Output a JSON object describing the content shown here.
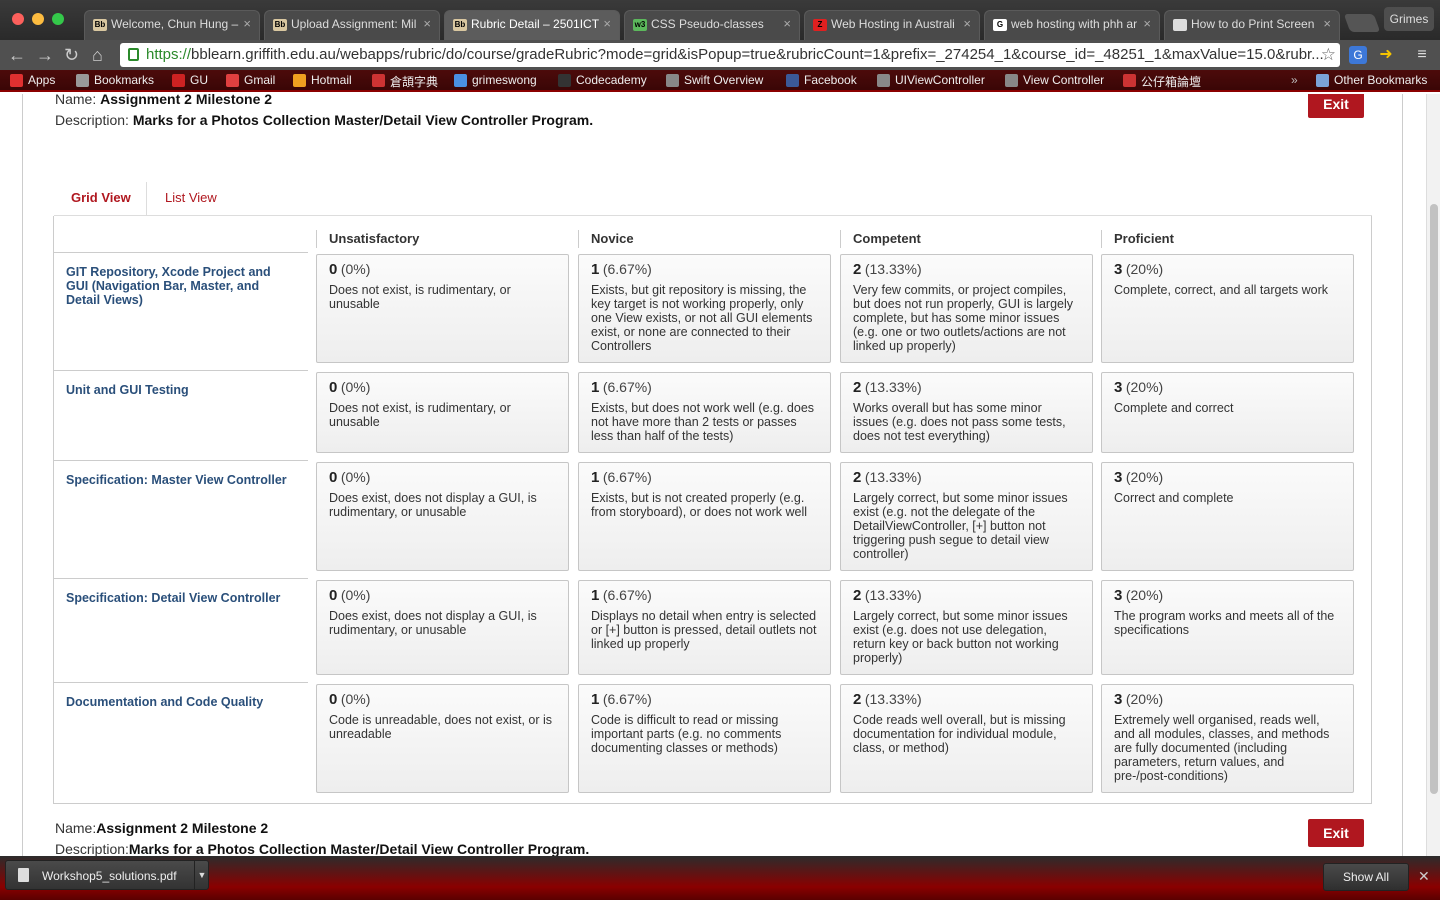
{
  "browser": {
    "tabs": [
      {
        "title": "Welcome, Chun Hung –",
        "favicon": "Bb"
      },
      {
        "title": "Upload Assignment: Mil",
        "favicon": "Bb"
      },
      {
        "title": "Rubric Detail – 2501ICT",
        "favicon": "Bb",
        "active": true
      },
      {
        "title": "CSS Pseudo-classes",
        "favicon": "w3"
      },
      {
        "title": "Web Hosting in Australi",
        "favicon": "Z"
      },
      {
        "title": "web hosting with phh ar",
        "favicon": "G"
      },
      {
        "title": "How to do Print Screen",
        "favicon": "doc"
      }
    ],
    "profile": "Grimes",
    "url_scheme": "https://",
    "url_rest": "bblearn.griffith.edu.au/webapps/rubric/do/course/gradeRubric?mode=grid&isPopup=true&rubricCount=1&prefix=_274254_1&course_id=_48251_1&maxValue=15.0&rubr..."
  },
  "bookmarks": [
    "Apps",
    "Bookmarks",
    "GU",
    "Gmail",
    "Hotmail",
    "倉頡字典",
    "grimeswong",
    "Codecademy",
    "Swift Overview",
    "Facebook",
    "UIViewController",
    "View Controller",
    "公仔箱論壇"
  ],
  "bookmarks_more": "»",
  "bookmarks_other": "Other Bookmarks",
  "rubric": {
    "name_label": "Name:",
    "name": "Assignment 2 Milestone 2",
    "description_label": "Description:",
    "description": "Marks for a Photos Collection Master/Detail View Controller Program.",
    "exit_label": "Exit",
    "tabs": {
      "grid": "Grid View",
      "list": "List View"
    },
    "levels": [
      "Unsatisfactory",
      "Novice",
      "Competent",
      "Proficient"
    ],
    "criteria": [
      {
        "name": "GIT Repository, Xcode Project and GUI (Navigation Bar, Master, and Detail Views)",
        "cells": [
          {
            "points": "0",
            "percent": "(0%)",
            "desc": "Does not exist, is rudimentary, or unusable"
          },
          {
            "points": "1",
            "percent": "(6.67%)",
            "desc": "Exists, but git repository is missing, the key target is not working properly, only one View exists, or not all GUI elements exist, or none are connected to their Controllers"
          },
          {
            "points": "2",
            "percent": "(13.33%)",
            "desc": "Very few commits, or project compiles, but does not run properly, GUI is largely complete, but has some minor issues (e.g. one or two outlets/actions are not linked up properly)"
          },
          {
            "points": "3",
            "percent": "(20%)",
            "desc": "Complete, correct, and all targets work"
          }
        ]
      },
      {
        "name": "Unit and GUI Testing",
        "cells": [
          {
            "points": "0",
            "percent": "(0%)",
            "desc": "Does not exist, is rudimentary, or unusable"
          },
          {
            "points": "1",
            "percent": "(6.67%)",
            "desc": "Exists, but does not work well (e.g. does not have more than 2 tests or passes less than half of the tests)"
          },
          {
            "points": "2",
            "percent": "(13.33%)",
            "desc": "Works overall but has some minor issues (e.g. does not pass some tests, does not test everything)"
          },
          {
            "points": "3",
            "percent": "(20%)",
            "desc": "Complete and correct"
          }
        ]
      },
      {
        "name": "Specification: Master View Controller",
        "cells": [
          {
            "points": "0",
            "percent": "(0%)",
            "desc": "Does exist, does not display a GUI, is rudimentary, or unusable"
          },
          {
            "points": "1",
            "percent": "(6.67%)",
            "desc": "Exists, but is not created properly (e.g. from storyboard), or does not work well"
          },
          {
            "points": "2",
            "percent": "(13.33%)",
            "desc": "Largely correct, but some minor issues exist (e.g. not the delegate of the DetailViewController, [+] button not triggering push segue to detail view controller)"
          },
          {
            "points": "3",
            "percent": "(20%)",
            "desc": "Correct and complete"
          }
        ]
      },
      {
        "name": "Specification: Detail View Controller",
        "cells": [
          {
            "points": "0",
            "percent": "(0%)",
            "desc": "Does exist, does not display a GUI, is rudimentary, or unusable"
          },
          {
            "points": "1",
            "percent": "(6.67%)",
            "desc": "Displays no detail when entry is selected or [+] button is pressed, detail outlets not linked up properly"
          },
          {
            "points": "2",
            "percent": "(13.33%)",
            "desc": "Largely correct, but some minor issues exist (e.g. does not use delegation, return key or back button not working properly)"
          },
          {
            "points": "3",
            "percent": "(20%)",
            "desc": "The program works and meets all of the specifications"
          }
        ]
      },
      {
        "name": "Documentation and Code Quality",
        "cells": [
          {
            "points": "0",
            "percent": "(0%)",
            "desc": "Code is unreadable, does not exist, or is unreadable"
          },
          {
            "points": "1",
            "percent": "(6.67%)",
            "desc": "Code is difficult to read or missing important parts (e.g. no comments documenting classes or methods)"
          },
          {
            "points": "2",
            "percent": "(13.33%)",
            "desc": "Code reads well overall, but is missing documentation for individual module, class, or method)"
          },
          {
            "points": "3",
            "percent": "(20%)",
            "desc": "Extremely well organised, reads well, and all modules, classes, and methods are fully documented (including parameters, return values, and pre-/post-conditions)"
          }
        ]
      }
    ]
  },
  "downloads": {
    "file": "Workshop5_solutions.pdf",
    "show_all": "Show All"
  },
  "colors": {
    "accent": "#b0171f",
    "criterion_text": "#2a4f7a"
  }
}
